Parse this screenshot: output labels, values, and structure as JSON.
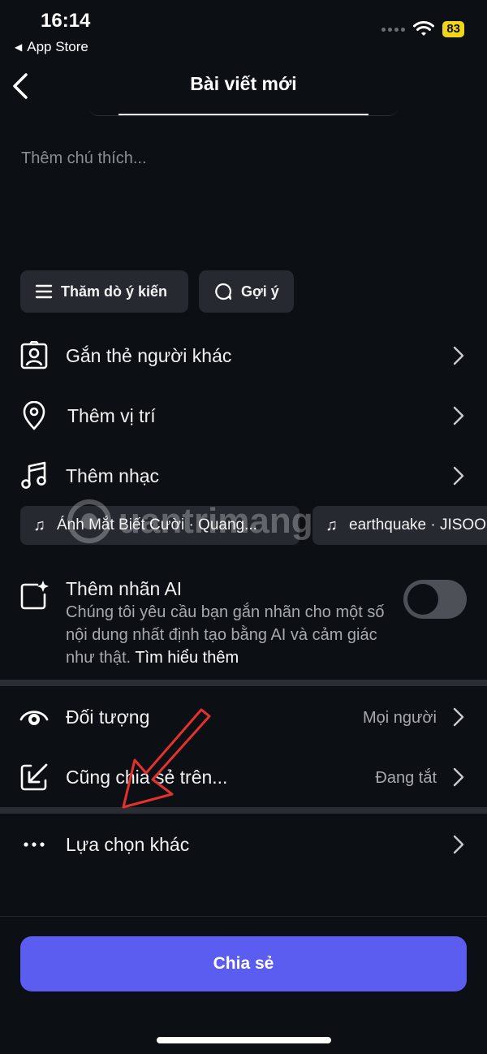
{
  "status_bar": {
    "time": "16:14",
    "back_app": "App Store",
    "battery": "83"
  },
  "header": {
    "title": "Bài viết mới"
  },
  "caption": {
    "placeholder": "Thêm chú thích..."
  },
  "chips": [
    {
      "label": "Thăm dò ý kiến",
      "icon": "list-icon"
    },
    {
      "label": "Gợi ý",
      "icon": "chat-bubble-icon"
    }
  ],
  "rows": {
    "tag_people": "Gắn thẻ người khác",
    "location": "Thêm vị trí",
    "music": "Thêm nhạc",
    "ai_label": "Thêm nhãn AI",
    "audience": "Đối tượng",
    "audience_value": "Mọi người",
    "share_also": "Cũng chia sẻ trên...",
    "share_also_value": "Đang tắt",
    "more_options": "Lựa chọn khác"
  },
  "music_suggestions": [
    "Ánh Mắt Biết Cười · Quang...",
    "earthquake · JISOO"
  ],
  "ai_description": {
    "text": "Chúng tôi yêu cầu bạn gắn nhãn cho một số nội dung nhất định tạo bằng AI và cảm giác như thật.",
    "link": "Tìm hiểu thêm"
  },
  "watermark": "uantrimang",
  "share_button": "Chia sẻ",
  "colors": {
    "accent": "#5b5cf0",
    "background": "#0c0f14",
    "chip": "#262a30",
    "battery": "#f1d51b"
  }
}
